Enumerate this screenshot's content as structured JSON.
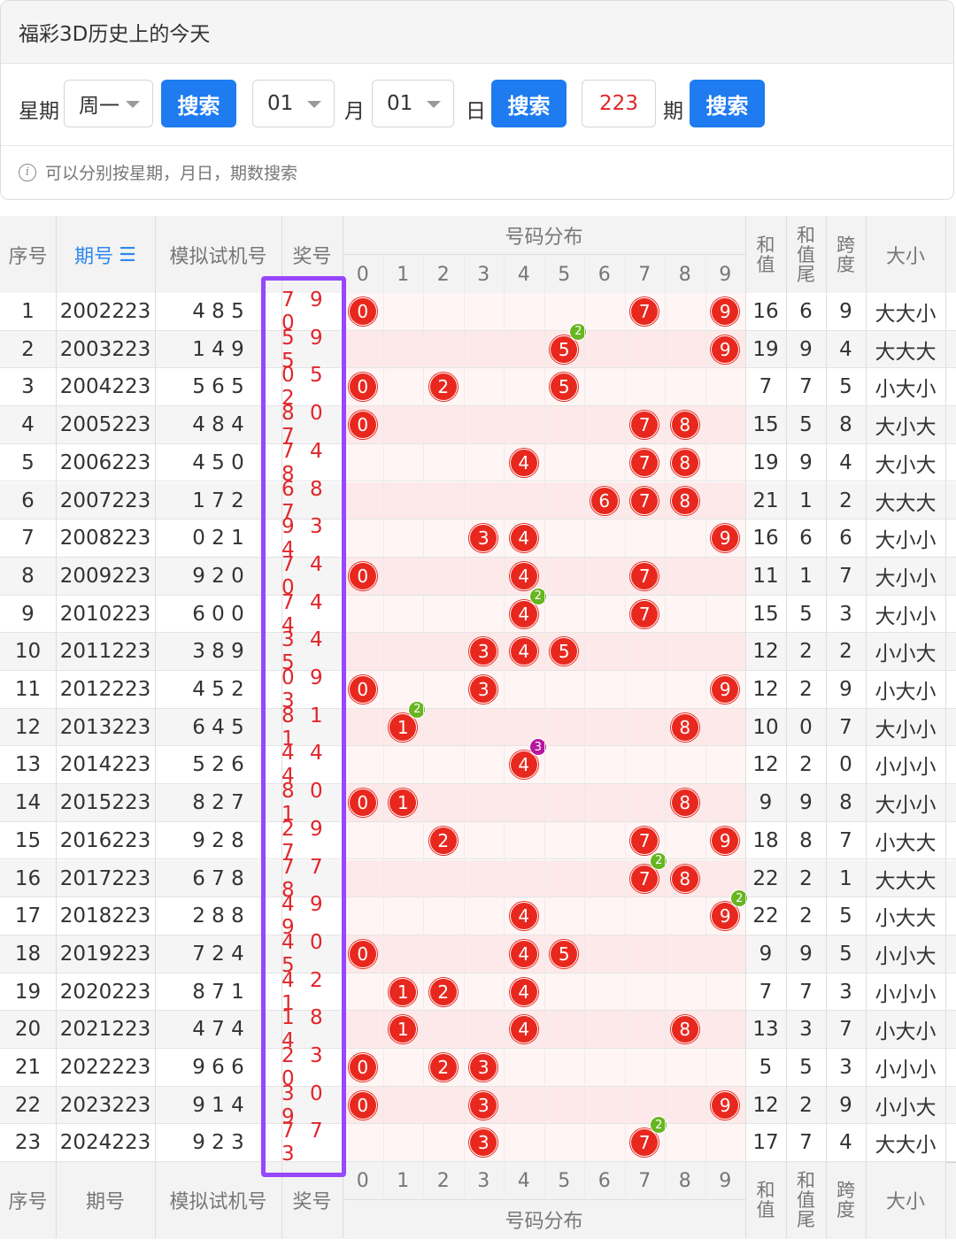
{
  "card": {
    "title": "福彩3D历史上的今天",
    "weekday_label": "星期",
    "weekday_value": "周一",
    "search_label": "搜索",
    "month_value": "01",
    "month_label": "月",
    "day_value": "01",
    "day_label": "日",
    "issue_value": "223",
    "issue_label": "期",
    "hint": "可以分别按星期，月日，期数搜索",
    "info_glyph": "i"
  },
  "table": {
    "header": {
      "seq": "序号",
      "issue": "期号",
      "sort_glyph": "☰",
      "machine": "模拟试机号",
      "award": "奖号",
      "dist": "号码分布",
      "digits": [
        "0",
        "1",
        "2",
        "3",
        "4",
        "5",
        "6",
        "7",
        "8",
        "9"
      ],
      "sum": [
        "和",
        "值"
      ],
      "sum_tail": [
        "和",
        "值",
        "尾"
      ],
      "span": [
        "跨",
        "度"
      ],
      "size": "大小"
    },
    "footer": {
      "seq": "序号",
      "issue": "期号",
      "machine": "模拟试机号",
      "award": "奖号",
      "dist": "号码分布",
      "size": "大小"
    },
    "rows": [
      {
        "seq": "1",
        "issue": "2002223",
        "machine": "4 8 5",
        "award": "7 9 0",
        "balls": [
          0,
          7,
          9
        ],
        "dup": null,
        "sum": "16",
        "tail": "6",
        "span": "9",
        "size": "大大小"
      },
      {
        "seq": "2",
        "issue": "2003223",
        "machine": "1 4 9",
        "award": "5 9 5",
        "balls": [
          5,
          9
        ],
        "dup": {
          "digit": 5,
          "count": "2"
        },
        "sum": "19",
        "tail": "9",
        "span": "4",
        "size": "大大大"
      },
      {
        "seq": "3",
        "issue": "2004223",
        "machine": "5 6 5",
        "award": "0 5 2",
        "balls": [
          0,
          2,
          5
        ],
        "dup": null,
        "sum": "7",
        "tail": "7",
        "span": "5",
        "size": "小大小"
      },
      {
        "seq": "4",
        "issue": "2005223",
        "machine": "4 8 4",
        "award": "8 0 7",
        "balls": [
          0,
          7,
          8
        ],
        "dup": null,
        "sum": "15",
        "tail": "5",
        "span": "8",
        "size": "大小大"
      },
      {
        "seq": "5",
        "issue": "2006223",
        "machine": "4 5 0",
        "award": "7 4 8",
        "balls": [
          4,
          7,
          8
        ],
        "dup": null,
        "sum": "19",
        "tail": "9",
        "span": "4",
        "size": "大小大"
      },
      {
        "seq": "6",
        "issue": "2007223",
        "machine": "1 7 2",
        "award": "6 8 7",
        "balls": [
          6,
          7,
          8
        ],
        "dup": null,
        "sum": "21",
        "tail": "1",
        "span": "2",
        "size": "大大大"
      },
      {
        "seq": "7",
        "issue": "2008223",
        "machine": "0 2 1",
        "award": "9 3 4",
        "balls": [
          3,
          4,
          9
        ],
        "dup": null,
        "sum": "16",
        "tail": "6",
        "span": "6",
        "size": "大小小"
      },
      {
        "seq": "8",
        "issue": "2009223",
        "machine": "9 2 0",
        "award": "7 4 0",
        "balls": [
          0,
          4,
          7
        ],
        "dup": null,
        "sum": "11",
        "tail": "1",
        "span": "7",
        "size": "大小小"
      },
      {
        "seq": "9",
        "issue": "2010223",
        "machine": "6 0 0",
        "award": "7 4 4",
        "balls": [
          4,
          7
        ],
        "dup": {
          "digit": 4,
          "count": "2"
        },
        "sum": "15",
        "tail": "5",
        "span": "3",
        "size": "大小小"
      },
      {
        "seq": "10",
        "issue": "2011223",
        "machine": "3 8 9",
        "award": "3 4 5",
        "balls": [
          3,
          4,
          5
        ],
        "dup": null,
        "sum": "12",
        "tail": "2",
        "span": "2",
        "size": "小小大"
      },
      {
        "seq": "11",
        "issue": "2012223",
        "machine": "4 5 2",
        "award": "0 9 3",
        "balls": [
          0,
          3,
          9
        ],
        "dup": null,
        "sum": "12",
        "tail": "2",
        "span": "9",
        "size": "小大小"
      },
      {
        "seq": "12",
        "issue": "2013223",
        "machine": "6 4 5",
        "award": "8 1 1",
        "balls": [
          1,
          8
        ],
        "dup": {
          "digit": 1,
          "count": "2"
        },
        "sum": "10",
        "tail": "0",
        "span": "7",
        "size": "大小小"
      },
      {
        "seq": "13",
        "issue": "2014223",
        "machine": "5 2 6",
        "award": "4 4 4",
        "balls": [
          4
        ],
        "dup": {
          "digit": 4,
          "count": "3"
        },
        "sum": "12",
        "tail": "2",
        "span": "0",
        "size": "小小小"
      },
      {
        "seq": "14",
        "issue": "2015223",
        "machine": "8 2 7",
        "award": "8 0 1",
        "balls": [
          0,
          1,
          8
        ],
        "dup": null,
        "sum": "9",
        "tail": "9",
        "span": "8",
        "size": "大小小"
      },
      {
        "seq": "15",
        "issue": "2016223",
        "machine": "9 2 8",
        "award": "2 9 7",
        "balls": [
          2,
          7,
          9
        ],
        "dup": null,
        "sum": "18",
        "tail": "8",
        "span": "7",
        "size": "小大大"
      },
      {
        "seq": "16",
        "issue": "2017223",
        "machine": "6 7 8",
        "award": "7 7 8",
        "balls": [
          7,
          8
        ],
        "dup": {
          "digit": 7,
          "count": "2"
        },
        "sum": "22",
        "tail": "2",
        "span": "1",
        "size": "大大大"
      },
      {
        "seq": "17",
        "issue": "2018223",
        "machine": "2 8 8",
        "award": "4 9 9",
        "balls": [
          4,
          9
        ],
        "dup": {
          "digit": 9,
          "count": "2"
        },
        "sum": "22",
        "tail": "2",
        "span": "5",
        "size": "小大大"
      },
      {
        "seq": "18",
        "issue": "2019223",
        "machine": "7 2 4",
        "award": "4 0 5",
        "balls": [
          0,
          4,
          5
        ],
        "dup": null,
        "sum": "9",
        "tail": "9",
        "span": "5",
        "size": "小小大"
      },
      {
        "seq": "19",
        "issue": "2020223",
        "machine": "8 7 1",
        "award": "4 2 1",
        "balls": [
          1,
          2,
          4
        ],
        "dup": null,
        "sum": "7",
        "tail": "7",
        "span": "3",
        "size": "小小小"
      },
      {
        "seq": "20",
        "issue": "2021223",
        "machine": "4 7 4",
        "award": "1 8 4",
        "balls": [
          1,
          4,
          8
        ],
        "dup": null,
        "sum": "13",
        "tail": "3",
        "span": "7",
        "size": "小大小"
      },
      {
        "seq": "21",
        "issue": "2022223",
        "machine": "9 6 6",
        "award": "2 3 0",
        "balls": [
          0,
          2,
          3
        ],
        "dup": null,
        "sum": "5",
        "tail": "5",
        "span": "3",
        "size": "小小小"
      },
      {
        "seq": "22",
        "issue": "2023223",
        "machine": "9 1 4",
        "award": "3 0 9",
        "balls": [
          0,
          3,
          9
        ],
        "dup": null,
        "sum": "12",
        "tail": "2",
        "span": "9",
        "size": "小小大"
      },
      {
        "seq": "23",
        "issue": "2024223",
        "machine": "9 2 3",
        "award": "7 7 3",
        "balls": [
          3,
          7
        ],
        "dup": {
          "digit": 7,
          "count": "2"
        },
        "sum": "17",
        "tail": "7",
        "span": "4",
        "size": "大大小"
      }
    ]
  },
  "colors": {
    "accent_blue": "#1e7bf0",
    "ball_red": "#e8281e",
    "dup2_green": "#67b520",
    "dup3_magenta": "#b5179e",
    "highlight_purple": "#9747ff"
  }
}
